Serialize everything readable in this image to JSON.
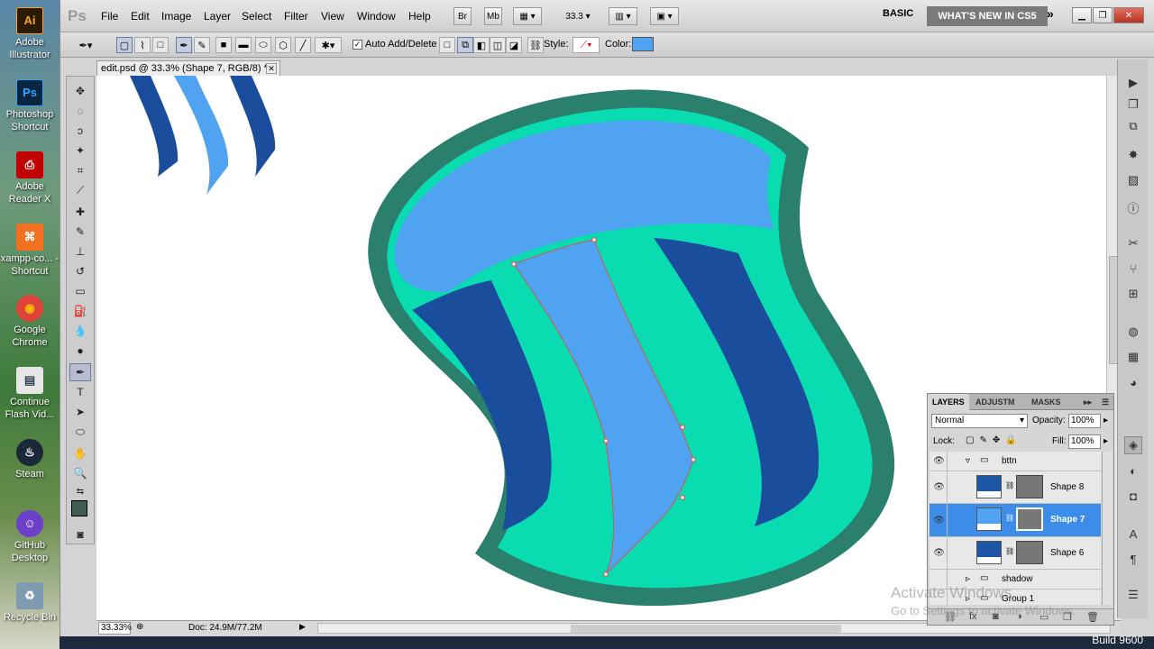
{
  "desktop": {
    "icons": [
      {
        "label": "Adobe Illustrator",
        "glyph": "Ai",
        "color": "#2b1b05",
        "fg": "#f7a41c"
      },
      {
        "label": "Photoshop Shortcut",
        "glyph": "Ps",
        "color": "#0a2540",
        "fg": "#31a8ff"
      },
      {
        "label": "Adobe Reader X",
        "glyph": "⎙",
        "color": "#c00000",
        "fg": "#ffffff"
      },
      {
        "label": "xampp-co... - Shortcut",
        "glyph": "⌘",
        "color": "#f37021",
        "fg": "#ffffff"
      },
      {
        "label": "Google Chrome",
        "glyph": "◉",
        "color": "#2a8f3a",
        "fg": "#fbbc05"
      },
      {
        "label": "Continue Flash Vid...",
        "glyph": "▤",
        "color": "#e6e6e6",
        "fg": "#345"
      },
      {
        "label": "Steam",
        "glyph": "♨",
        "color": "#1b2838",
        "fg": "#ffffff"
      },
      {
        "label": "GitHub Desktop",
        "glyph": "☺",
        "color": "#6e40c9",
        "fg": "#ffffff"
      },
      {
        "label": "Recycle Bin",
        "glyph": "♻",
        "color": "#7f9bb0",
        "fg": "#ffffff"
      }
    ]
  },
  "menubar": {
    "logo": "Ps",
    "items": [
      "File",
      "Edit",
      "Image",
      "Layer",
      "Select",
      "Filter",
      "View",
      "Window",
      "Help"
    ],
    "bridge": "Br",
    "minibridge": "Mb",
    "zoom": "33.3",
    "workspace_basic": "BASIC",
    "workspace_active": "WHAT'S NEW IN CS5",
    "more": "»"
  },
  "options": {
    "auto_add_delete": "Auto Add/Delete",
    "style_label": "Style:",
    "color_label": "Color:",
    "color": "#4fa3f0"
  },
  "document": {
    "tab_title": "edit.psd @ 33.3% (Shape 7, RGB/8) *",
    "zoom": "33.33%",
    "doc_info": "Doc: 24.9M/77.2M"
  },
  "artwork": {
    "outer_ring": "#2a7f6d",
    "fill": "#09dcb0",
    "light_blue": "#4fa3f0",
    "dark_blue": "#1a4e9c"
  },
  "layers_panel": {
    "tabs": [
      "LAYERS",
      "ADJUSTM",
      "MASKS"
    ],
    "blend_mode": "Normal",
    "opacity_label": "Opacity:",
    "opacity": "100%",
    "lock_label": "Lock:",
    "fill_label": "Fill:",
    "fill": "100%",
    "layers": [
      {
        "name": "bttn",
        "type": "group-open"
      },
      {
        "name": "Shape 8",
        "type": "shape"
      },
      {
        "name": "Shape 7",
        "type": "shape-selected"
      },
      {
        "name": "Shape 6",
        "type": "shape"
      },
      {
        "name": "shadow",
        "type": "group"
      },
      {
        "name": "Group 1",
        "type": "group"
      }
    ]
  },
  "overlay": {
    "activate_line1": "Activate Windows",
    "activate_line2": "Go to Settings to activate Windows.",
    "build": "Build 9600"
  }
}
